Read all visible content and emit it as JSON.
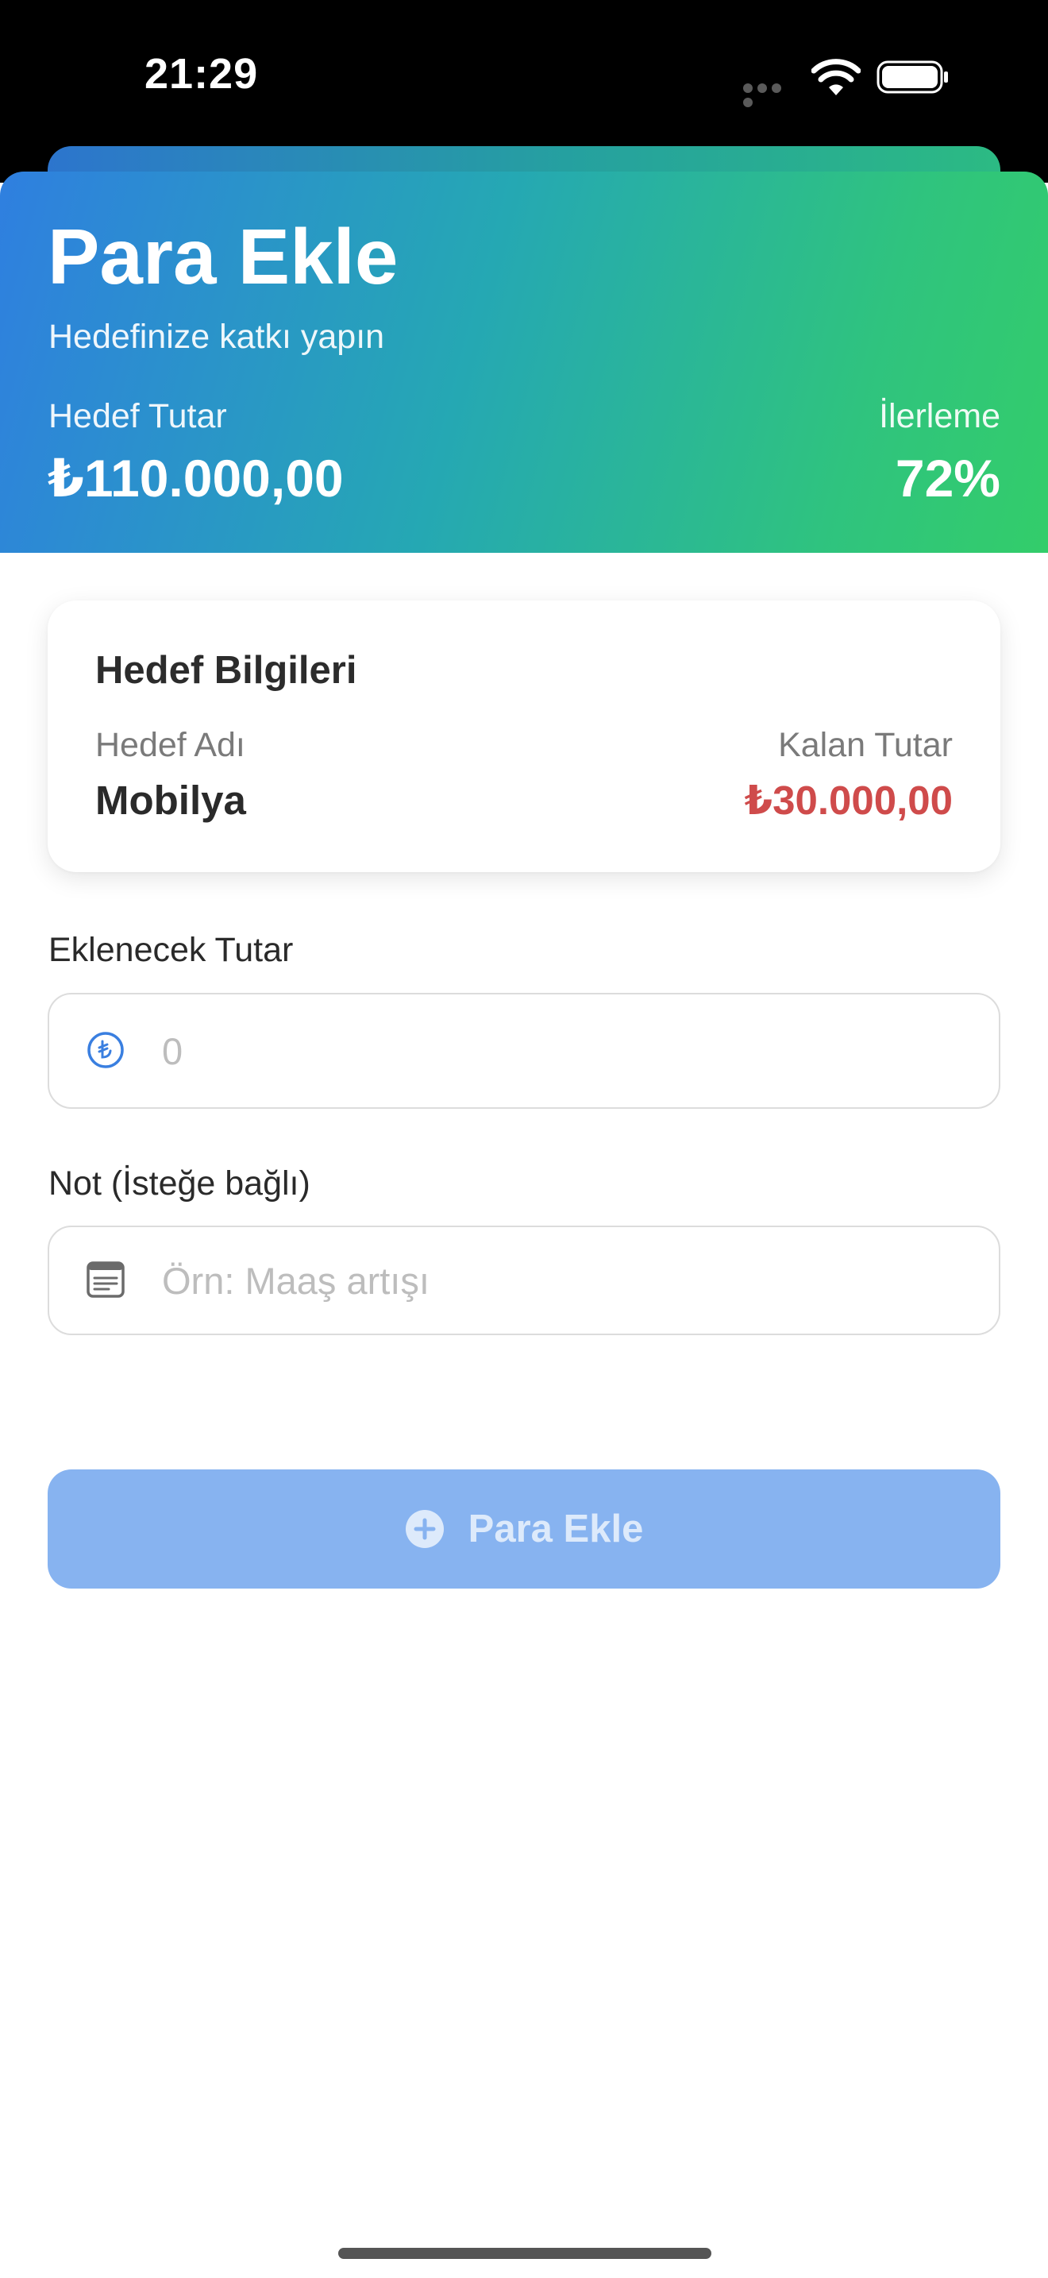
{
  "status_bar": {
    "time": "21:29"
  },
  "header": {
    "title": "Para Ekle",
    "subtitle": "Hedefinize katkı yapın",
    "target_label": "Hedef Tutar",
    "target_value": "₺110.000,00",
    "progress_label": "İlerleme",
    "progress_value": "72%",
    "gradient_start": "#2f7fe0",
    "gradient_end": "#33cd6a"
  },
  "info_card": {
    "title": "Hedef Bilgileri",
    "name_label": "Hedef Adı",
    "name_value": "Mobilya",
    "remaining_label": "Kalan Tutar",
    "remaining_value": "₺30.000,00",
    "remaining_color": "#cf4b4b"
  },
  "amount_field": {
    "label": "Eklenecek Tutar",
    "placeholder": "0",
    "value": "",
    "icon": "lira-circle-icon"
  },
  "note_field": {
    "label": "Not (İsteğe bağlı)",
    "placeholder": "Örn: Maaş artışı",
    "value": "",
    "icon": "note-icon"
  },
  "submit_button": {
    "label": "Para Ekle",
    "icon": "plus-circle-icon",
    "color": "#87b3f0"
  }
}
